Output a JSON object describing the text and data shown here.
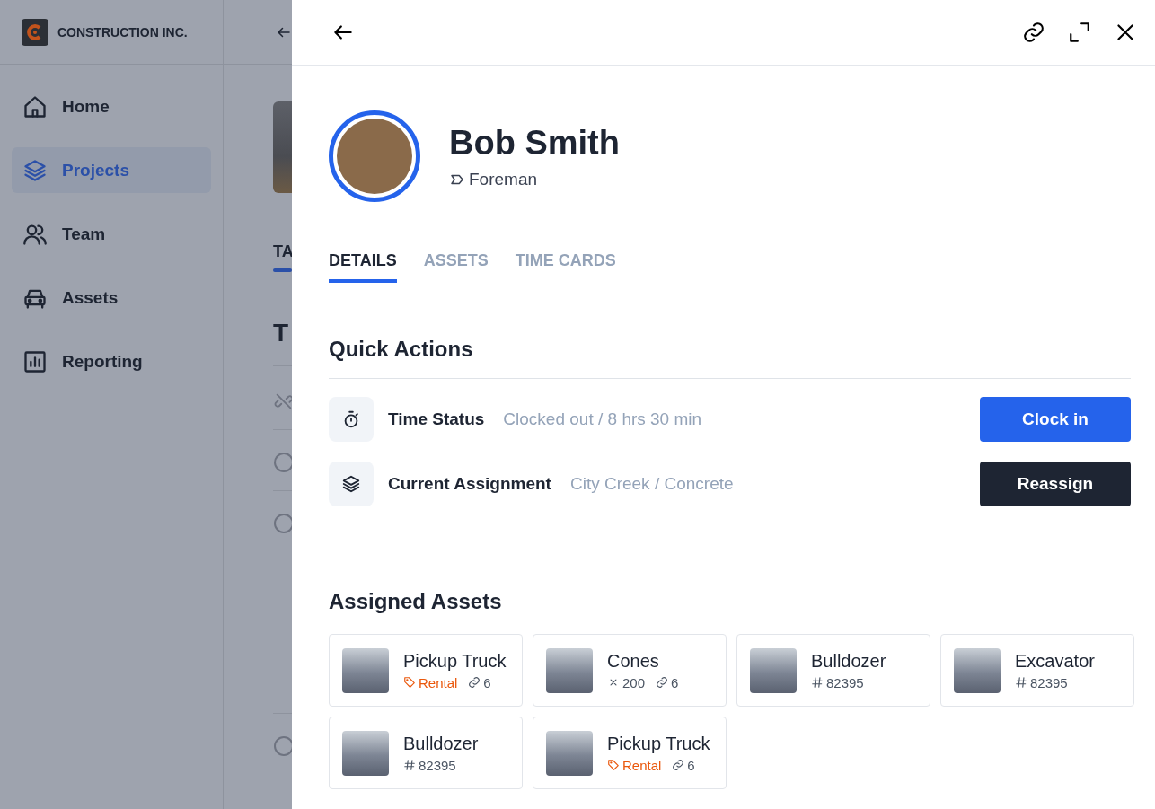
{
  "sidebar": {
    "brand": "CONSTRUCTION INC.",
    "items": [
      {
        "label": "Home",
        "selected": false
      },
      {
        "label": "Projects",
        "selected": true
      },
      {
        "label": "Team",
        "selected": false
      },
      {
        "label": "Assets",
        "selected": false
      },
      {
        "label": "Reporting",
        "selected": false
      }
    ]
  },
  "background_page": {
    "tab": "TA",
    "heading": "T"
  },
  "panel": {
    "name": "Bob Smith",
    "role": "Foreman",
    "tabs": [
      {
        "label": "DETAILS",
        "selected": true
      },
      {
        "label": "ASSETS",
        "selected": false
      },
      {
        "label": "TIME CARDS",
        "selected": false
      }
    ],
    "quick_actions": {
      "title": "Quick Actions",
      "rows": [
        {
          "label": "Time Status",
          "value": "Clocked out / 8 hrs 30 min",
          "button": "Clock in",
          "kind": "primary"
        },
        {
          "label": "Current Assignment",
          "value": "City Creek / Concrete",
          "button": "Reassign",
          "kind": "dark"
        }
      ]
    },
    "assigned_assets": {
      "title": "Assigned Assets",
      "items": [
        {
          "name": "Pickup Truck",
          "meta": [
            {
              "kind": "tag",
              "text": "Rental"
            },
            {
              "kind": "links",
              "text": "6"
            }
          ]
        },
        {
          "name": "Cones",
          "meta": [
            {
              "kind": "count",
              "text": "200"
            },
            {
              "kind": "links",
              "text": "6"
            }
          ]
        },
        {
          "name": "Bulldozer",
          "meta": [
            {
              "kind": "number",
              "text": "82395"
            }
          ]
        },
        {
          "name": "Excavator",
          "meta": [
            {
              "kind": "number",
              "text": "82395"
            }
          ]
        },
        {
          "name": "Bulldozer",
          "meta": [
            {
              "kind": "number",
              "text": "82395"
            }
          ]
        },
        {
          "name": "Pickup Truck",
          "meta": [
            {
              "kind": "tag",
              "text": "Rental"
            },
            {
              "kind": "links",
              "text": "6"
            }
          ]
        }
      ]
    }
  }
}
